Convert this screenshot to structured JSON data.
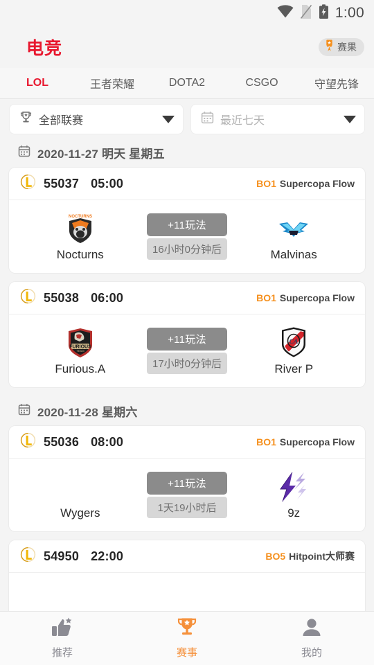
{
  "statusbar": {
    "time": "1:00",
    "icons": [
      "wifi-icon",
      "no-sim-icon",
      "battery-charging-icon"
    ]
  },
  "header": {
    "title": "电竞",
    "results_chip": {
      "label": "赛果",
      "icon": "medal-icon"
    }
  },
  "tabs": [
    {
      "label": "LOL",
      "active": true
    },
    {
      "label": "王者荣耀",
      "active": false
    },
    {
      "label": "DOTA2",
      "active": false
    },
    {
      "label": "CSGO",
      "active": false
    },
    {
      "label": "守望先锋",
      "active": false
    }
  ],
  "filters": {
    "league": {
      "value": "全部联赛",
      "icon": "trophy-icon"
    },
    "date": {
      "placeholder": "最近七天",
      "icon": "calendar-icon"
    }
  },
  "colors": {
    "accent_red": "#e8172e",
    "accent_orange": "#f5901e",
    "page_bg": "#f4f4f4",
    "card_bg": "#ffffff"
  },
  "sections": [
    {
      "date_label": "2020-11-27 明天 星期五",
      "matches": [
        {
          "id": "55037",
          "time": "05:00",
          "bo": "BO1",
          "league": "Supercopa Flow",
          "game_icon": "lol-icon",
          "home": {
            "name": "Nocturns",
            "logo": "nocturns-bear-logo"
          },
          "away": {
            "name": "Malvinas",
            "logo": "malvinas-wings-logo"
          },
          "play_label": "+11玩法",
          "countdown": "16小时0分钟后"
        },
        {
          "id": "55038",
          "time": "06:00",
          "bo": "BO1",
          "league": "Supercopa Flow",
          "game_icon": "lol-icon",
          "home": {
            "name": "Furious.A",
            "logo": "furious-shield-logo"
          },
          "away": {
            "name": "River P",
            "logo": "river-plate-shield-logo"
          },
          "play_label": "+11玩法",
          "countdown": "17小时0分钟后"
        }
      ]
    },
    {
      "date_label": "2020-11-28 星期六",
      "matches": [
        {
          "id": "55036",
          "time": "08:00",
          "bo": "BO1",
          "league": "Supercopa Flow",
          "game_icon": "lol-icon",
          "home": {
            "name": "Wygers",
            "logo": "none"
          },
          "away": {
            "name": "9z",
            "logo": "9z-bolt-logo"
          },
          "play_label": "+11玩法",
          "countdown": "1天19小时后"
        },
        {
          "id": "54950",
          "time": "22:00",
          "bo": "BO5",
          "league": "Hitpoint大师赛",
          "game_icon": "lol-icon",
          "partial": true
        }
      ]
    }
  ],
  "bottomnav": [
    {
      "label": "推荐",
      "icon": "thumbs-up-star-icon",
      "active": false
    },
    {
      "label": "赛事",
      "icon": "trophy-star-icon",
      "active": true
    },
    {
      "label": "我的",
      "icon": "person-icon",
      "active": false
    }
  ]
}
